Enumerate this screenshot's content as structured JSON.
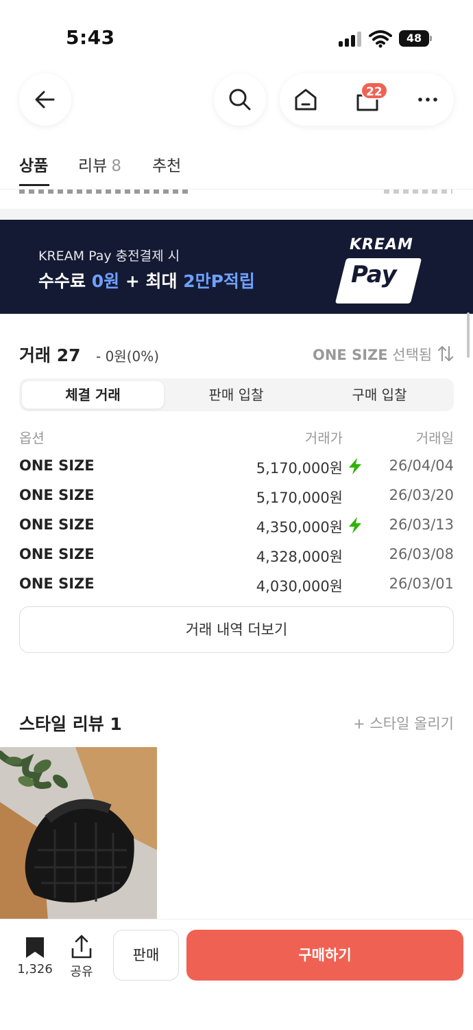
{
  "status_bar": {
    "time": "5:43",
    "battery": "48"
  },
  "header": {
    "cart_badge": "22"
  },
  "tabs": [
    {
      "label": "상품"
    },
    {
      "label": "리뷰",
      "count": "8"
    },
    {
      "label": "추천"
    }
  ],
  "pay_banner": {
    "line1": "KREAM Pay 충전결제 시",
    "line2_a": "수수료 ",
    "line2_hl1": "0원",
    "line2_b": " + 최대 ",
    "line2_hl2": "2만P적립",
    "logo_top": "KREAM",
    "logo_main": "Pay"
  },
  "trades": {
    "title": "거래 27",
    "sub": "- 0원(0%)",
    "size_strong": "ONE SIZE",
    "size_suffix": " 선택됨",
    "segments": [
      "체결 거래",
      "판매 입찰",
      "구매 입찰"
    ],
    "headers": {
      "option": "옵션",
      "price": "거래가",
      "date": "거래일"
    },
    "rows": [
      {
        "option": "ONE SIZE",
        "price": "5,170,000원",
        "date": "26/04/04",
        "quick": true
      },
      {
        "option": "ONE SIZE",
        "price": "5,170,000원",
        "date": "26/03/20",
        "quick": false
      },
      {
        "option": "ONE SIZE",
        "price": "4,350,000원",
        "date": "26/03/13",
        "quick": true
      },
      {
        "option": "ONE SIZE",
        "price": "4,328,000원",
        "date": "26/03/08",
        "quick": false
      },
      {
        "option": "ONE SIZE",
        "price": "4,030,000원",
        "date": "26/03/01",
        "quick": false
      }
    ],
    "more_label": "거래 내역 더보기"
  },
  "style_review": {
    "title": "스타일 리뷰 1",
    "upload_label": "+ 스타일 올리기"
  },
  "bottom_bar": {
    "bookmark_count": "1,326",
    "share_label": "공유",
    "sell_label": "판매",
    "buy_label": "구매하기"
  },
  "colors": {
    "accent_red": "#ef6253",
    "pay_banner_bg": "#141a33",
    "pay_highlight": "#6fa0ff",
    "quick_bolt": "#2db400"
  },
  "icons": [
    "back-arrow-icon",
    "search-icon",
    "home-icon",
    "bag-icon",
    "more-icon",
    "sort-icon",
    "lightning-icon",
    "bookmark-icon",
    "share-icon"
  ]
}
